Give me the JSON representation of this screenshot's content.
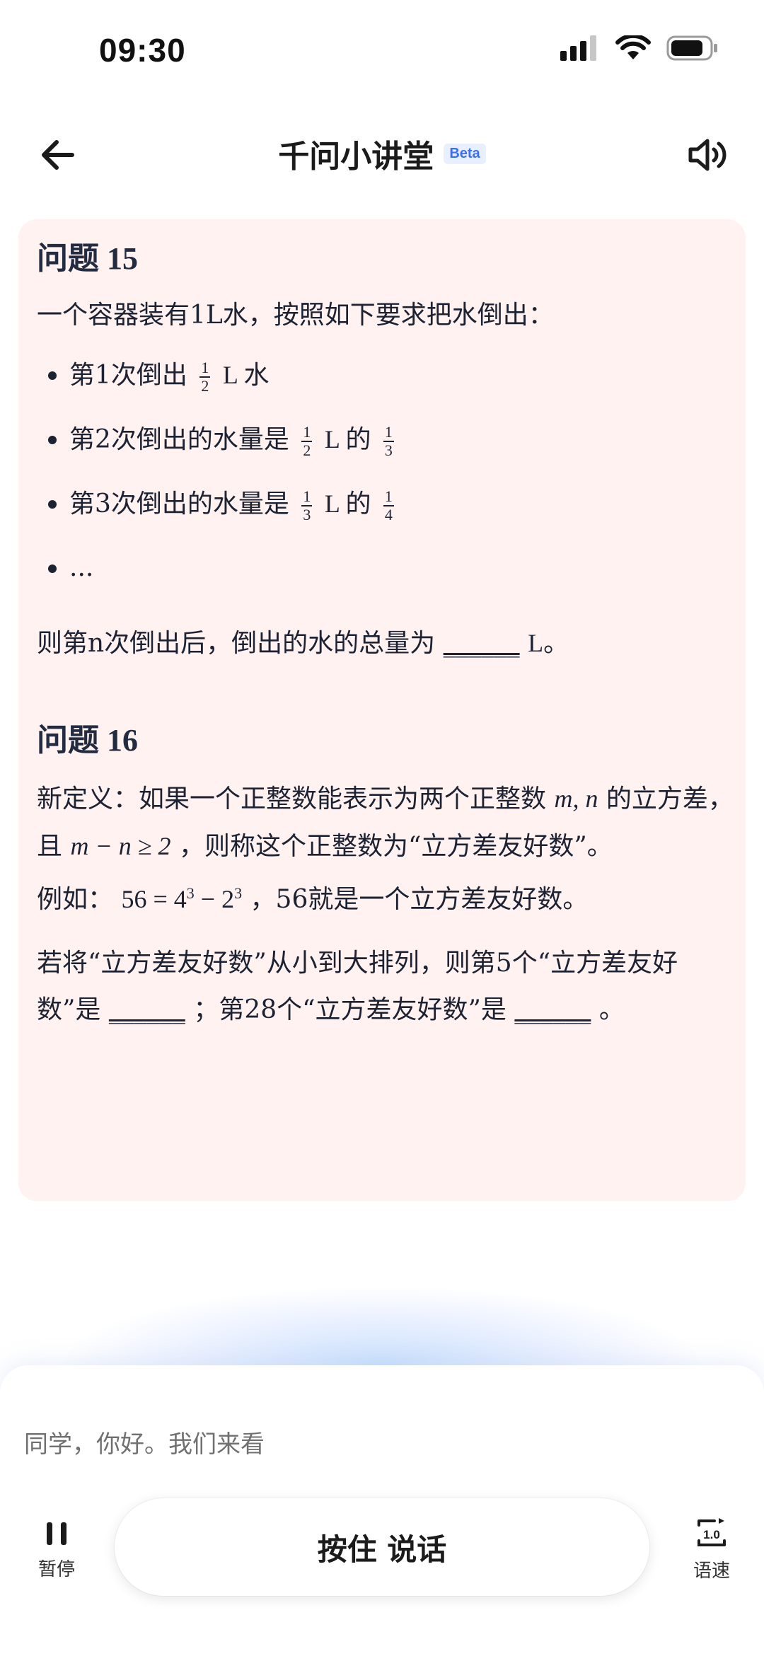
{
  "status_bar": {
    "time": "09:30"
  },
  "nav": {
    "title": "千问小讲堂",
    "badge": "Beta"
  },
  "question15": {
    "title": "问题 15",
    "intro": "一个容器装有1L水，按照如下要求把水倒出：",
    "items": [
      {
        "text": "第1次倒出",
        "frac1": {
          "num": "1",
          "den": "2"
        },
        "suffix": "L 水"
      },
      {
        "text": "第2次倒出的水量是",
        "frac1": {
          "num": "1",
          "den": "2"
        },
        "mid": "L 的",
        "frac2": {
          "num": "1",
          "den": "3"
        }
      },
      {
        "text": "第3次倒出的水量是",
        "frac1": {
          "num": "1",
          "den": "3"
        },
        "mid": "L 的",
        "frac2": {
          "num": "1",
          "den": "4"
        }
      },
      {
        "text": "..."
      }
    ],
    "conclusion_before": "则第n次倒出后，倒出的水的总量为",
    "blank": "______",
    "conclusion_after": "L。"
  },
  "question16": {
    "title": "问题 16",
    "def_1": "新定义：如果一个正整数能表示为两个正整数",
    "def_vars": "m, n",
    "def_2": "的立方差，且",
    "def_cond": "m − n ≥ 2",
    "def_3": "，则称这个正整数为“立方差友好数”。",
    "example_prefix": "例如：",
    "example_lhs": "56 = 4",
    "example_exp1": "3",
    "example_mid": " − 2",
    "example_exp2": "3",
    "example_suffix": "，56就是一个立方差友好数。",
    "ask_1": "若将“立方差友好数”从小到大排列，则第5个“立方差友好数”是",
    "blank1": "______",
    "ask_2": "；第28个“立方差友好数”是",
    "blank2": "______",
    "ask_end": "。"
  },
  "bottom": {
    "transcript": "同学，你好。我们来看",
    "pause_label": "暂停",
    "talk_label": "按住 说话",
    "speed_value": "1.0",
    "speed_label": "语速"
  }
}
